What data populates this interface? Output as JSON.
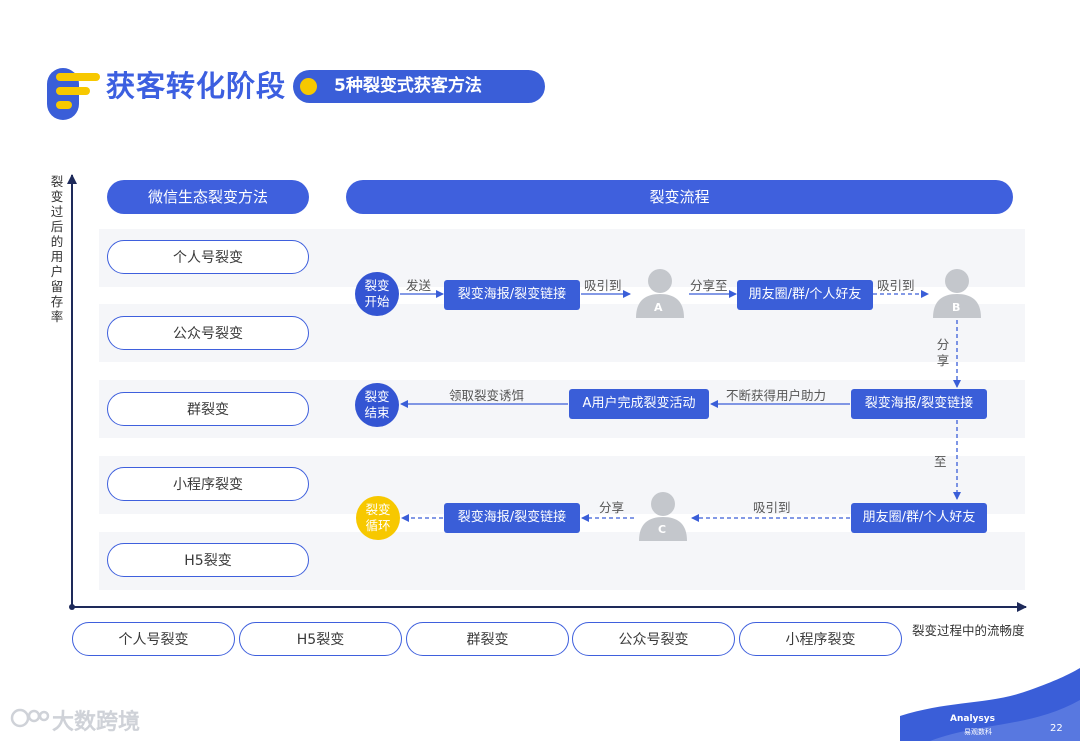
{
  "header": {
    "title": "获客转化阶段",
    "subtitle": "5种裂变式获客方法"
  },
  "axes": {
    "y_label": "裂变过后的用户留存率",
    "x_label": "裂变过程中的流畅度"
  },
  "left_column": {
    "heading": "微信生态裂变方法",
    "methods": [
      "个人号裂变",
      "公众号裂变",
      "群裂变",
      "小程序裂变",
      "H5裂变"
    ]
  },
  "flow": {
    "heading": "裂变流程",
    "start": "裂变\n开始",
    "end": "裂变\n结束",
    "loop": "裂变\n循环",
    "row1": {
      "send": "发送",
      "poster": "裂变海报/裂变链接",
      "attract1": "吸引到",
      "user_a": "A",
      "share_to": "分享至",
      "moments": "朋友圈/群/个人好友",
      "attract2": "吸引到",
      "user_b": "B"
    },
    "down1": "分\n享",
    "row2": {
      "poster": "裂变海报/裂变链接",
      "keep_help": "不断获得用户助力",
      "complete": "A用户完成裂变活动",
      "claim": "领取裂变诱饵"
    },
    "down2": "至",
    "row3": {
      "moments": "朋友圈/群/个人好友",
      "attract": "吸引到",
      "user_c": "C",
      "share": "分享",
      "poster": "裂变海报/裂变链接"
    }
  },
  "x_ranking": [
    "个人号裂变",
    "H5裂变",
    "群裂变",
    "公众号裂变",
    "小程序裂变"
  ],
  "footer": {
    "watermark": "大数跨境",
    "brand": "Analysys",
    "brand_sub": "易观数科",
    "page": "22"
  },
  "colors": {
    "primary": "#3a5ed8",
    "accent": "#f7c800",
    "band": "#f5f6f9",
    "avatar": "#c4c7cc"
  }
}
